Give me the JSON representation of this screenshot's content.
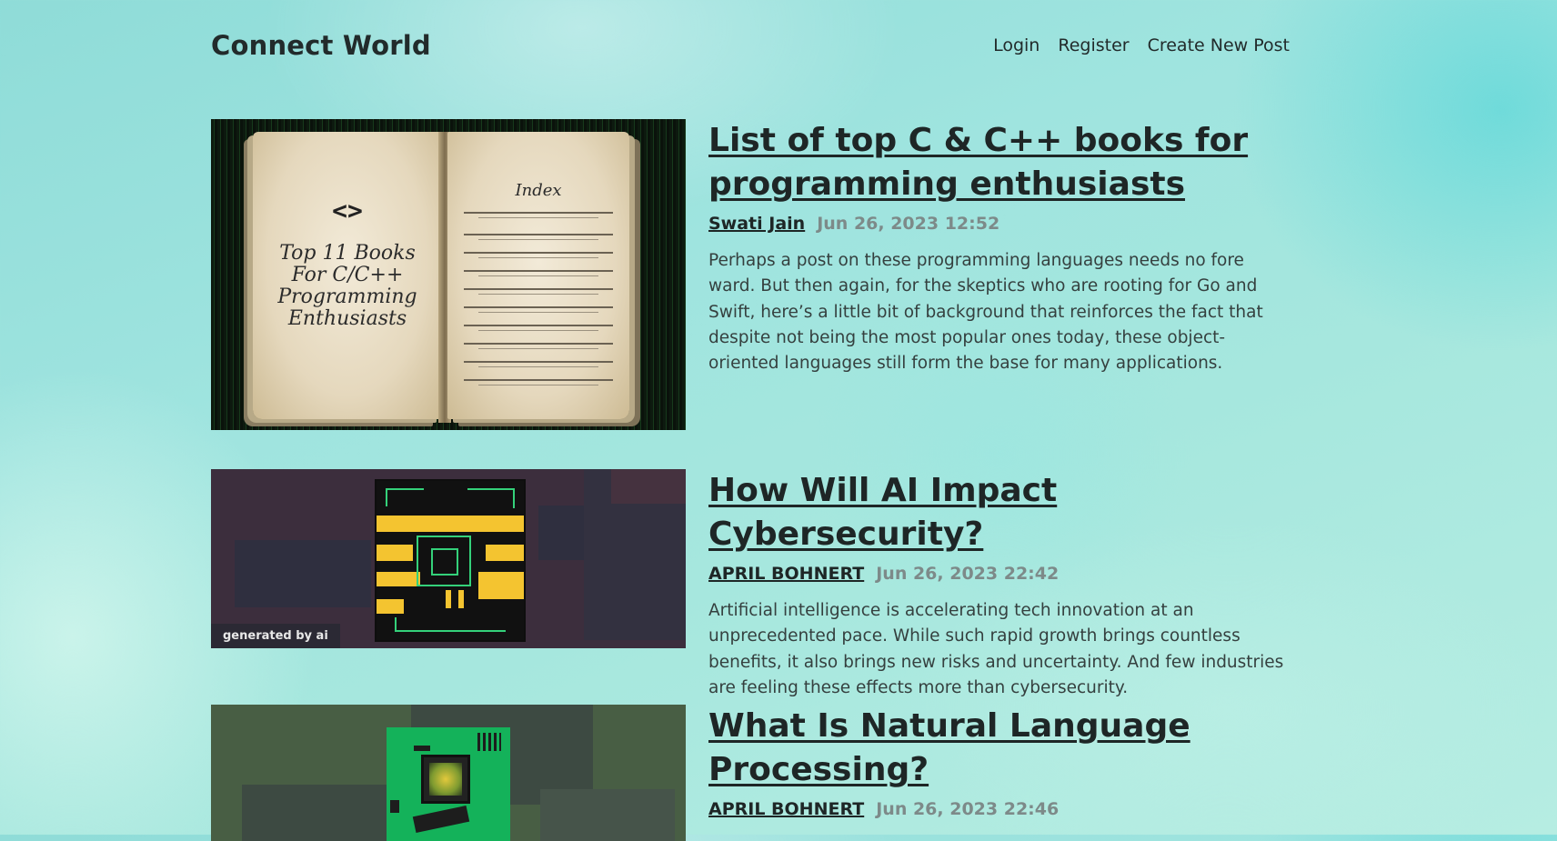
{
  "site": {
    "brand": "Connect World",
    "nav": {
      "login": "Login",
      "register": "Register",
      "create": "Create New Post"
    }
  },
  "posts": [
    {
      "title": "List of top C & C++ books for programming enthusiasts",
      "author": "Swati Jain",
      "date": "Jun 26, 2023 12:52",
      "excerpt": "Perhaps a post on these programming languages needs no fore ward. But then again, for the skeptics who are rooting for Go and Swift, here’s a little bit of background that reinforces the fact that despite not being the most popular ones today, these object-oriented languages still form the base for many applications.",
      "image": {
        "chevron": "<>",
        "cover_text": "Top 11 Books For C/C++ Programming Enthusiasts",
        "index_heading": "Index"
      }
    },
    {
      "title": "How Will AI Impact Cybersecurity?",
      "author": "APRIL BOHNERT",
      "date": "Jun 26, 2023 22:42",
      "excerpt": "Artificial intelligence is accelerating tech innovation at an unprecedented pace. While such rapid growth brings countless benefits, it also brings new risks and uncertainty. And few industries are feeling these effects more than cybersecurity.",
      "image": {
        "tag": "generated by ai"
      }
    },
    {
      "title": "What Is Natural Language Processing?",
      "author": "APRIL BOHNERT",
      "date": "Jun 26, 2023 22:46",
      "excerpt": ""
    }
  ]
}
